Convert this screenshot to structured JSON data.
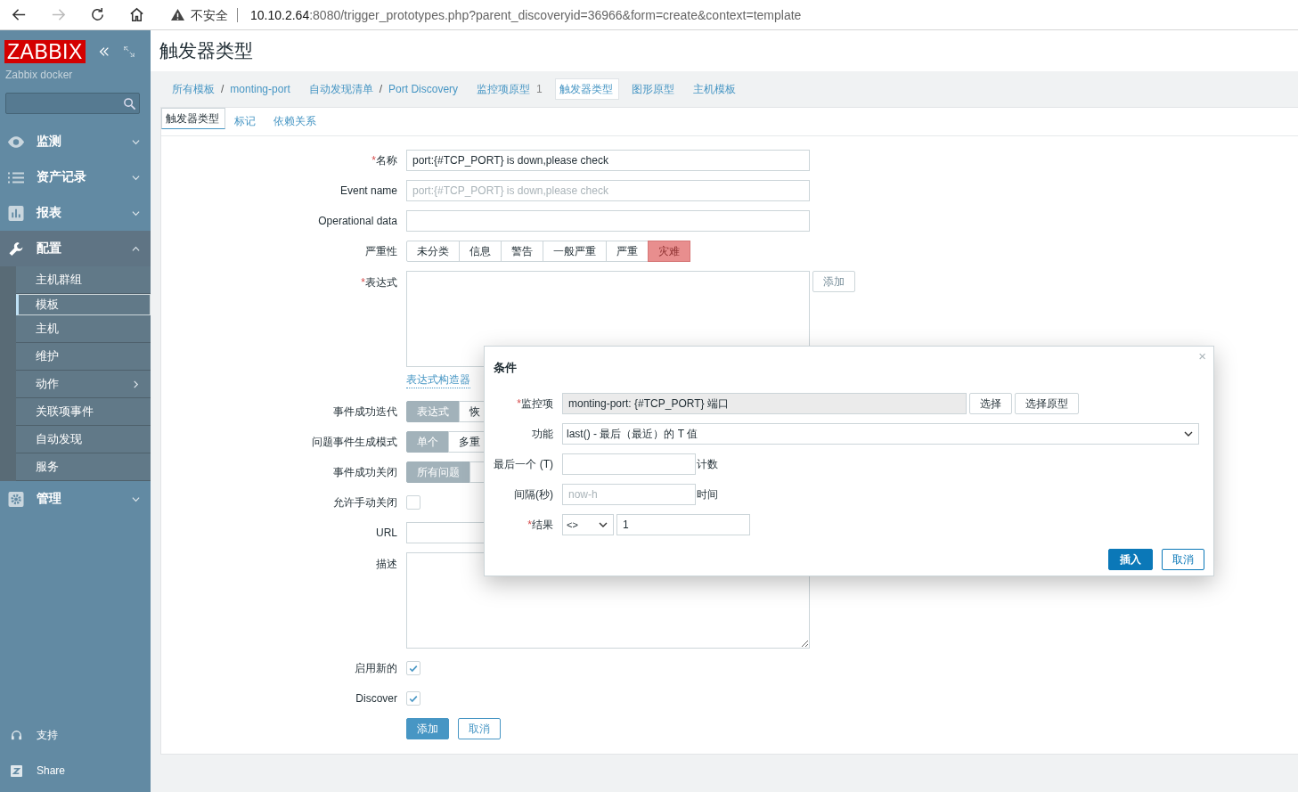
{
  "required_mark": "*",
  "browser": {
    "security": "不安全",
    "host": "10.10.2.64",
    "path": ":8080/trigger_prototypes.php?parent_discoveryid=36966&form=create&context=template"
  },
  "sidebar": {
    "logo": "ZABBIX",
    "server": "Zabbix docker",
    "menu": [
      {
        "label": "监测",
        "expanded": false
      },
      {
        "label": "资产记录",
        "expanded": false
      },
      {
        "label": "报表",
        "expanded": false
      },
      {
        "label": "配置",
        "expanded": true,
        "children": [
          {
            "label": "主机群组",
            "selected": false,
            "has_submenu": false
          },
          {
            "label": "模板",
            "selected": true,
            "has_submenu": false
          },
          {
            "label": "主机",
            "selected": false,
            "has_submenu": false
          },
          {
            "label": "维护",
            "selected": false,
            "has_submenu": false
          },
          {
            "label": "动作",
            "selected": false,
            "has_submenu": true
          },
          {
            "label": "关联项事件",
            "selected": false,
            "has_submenu": false
          },
          {
            "label": "自动发现",
            "selected": false,
            "has_submenu": false
          },
          {
            "label": "服务",
            "selected": false,
            "has_submenu": false
          }
        ]
      },
      {
        "label": "管理",
        "expanded": false
      }
    ],
    "footer": [
      "支持",
      "Share"
    ]
  },
  "page": {
    "title": "触发器类型",
    "breadcrumbs": {
      "separator": "/",
      "groups": [
        {
          "items": [
            "所有模板",
            "monting-port"
          ],
          "selected": false
        },
        {
          "items": [
            "自动发现清单",
            "Port Discovery"
          ],
          "selected": false
        },
        {
          "items": [
            "监控项原型"
          ],
          "count": "1",
          "selected": false
        },
        {
          "items": [
            "触发器类型"
          ],
          "selected": true
        },
        {
          "items": [
            "图形原型"
          ],
          "selected": false
        },
        {
          "items": [
            "主机模板"
          ],
          "selected": false
        }
      ]
    },
    "tabs": [
      {
        "label": "触发器类型",
        "selected": true
      },
      {
        "label": "标记",
        "selected": false
      },
      {
        "label": "依赖关系",
        "selected": false
      }
    ],
    "fields": [
      {
        "kind": "input",
        "label": "名称",
        "required": true,
        "value": "port:{#TCP_PORT} is down,please check"
      },
      {
        "kind": "input",
        "label": "Event name",
        "required": false,
        "placeholder": "port:{#TCP_PORT} is down,please check"
      },
      {
        "kind": "input",
        "label": "Operational data",
        "required": false
      },
      {
        "kind": "severity",
        "label": "严重性",
        "required": false,
        "options": [
          {
            "label": "未分类",
            "selected": false
          },
          {
            "label": "信息",
            "selected": false
          },
          {
            "label": "警告",
            "selected": false
          },
          {
            "label": "一般严重",
            "selected": false
          },
          {
            "label": "严重",
            "selected": false
          },
          {
            "label": "灾难",
            "selected": true
          }
        ]
      },
      {
        "kind": "expression",
        "label": "表达式",
        "required": true,
        "button": "添加",
        "link": "表达式构造器"
      },
      {
        "kind": "segmented",
        "label": "事件成功迭代",
        "required": false,
        "options": [
          {
            "label": "表达式",
            "selected": true
          },
          {
            "label": "恢",
            "selected": false
          }
        ]
      },
      {
        "kind": "segmented",
        "label": "问题事件生成模式",
        "required": false,
        "options": [
          {
            "label": "单个",
            "selected": true
          },
          {
            "label": "多重",
            "selected": false
          }
        ]
      },
      {
        "kind": "segmented",
        "label": "事件成功关闭",
        "required": false,
        "options": [
          {
            "label": "所有问题",
            "selected": true
          },
          {
            "selected": false
          }
        ]
      },
      {
        "kind": "checkbox",
        "label": "允许手动关闭",
        "required": false,
        "checked": false
      },
      {
        "kind": "input",
        "label": "URL",
        "required": false
      },
      {
        "kind": "textarea",
        "label": "描述",
        "required": false
      },
      {
        "kind": "checkbox",
        "label": "启用新的",
        "required": false,
        "checked": true
      },
      {
        "kind": "checkbox",
        "label": "Discover",
        "required": false,
        "checked": true
      }
    ],
    "actions": [
      {
        "label": "添加",
        "primary": true
      },
      {
        "label": "取消",
        "primary": false
      }
    ]
  },
  "dialog": {
    "title": "条件",
    "close": "×",
    "rows": [
      {
        "kind": "item",
        "label": "监控项",
        "required": true,
        "value": "monting-port: {#TCP_PORT} 端口",
        "buttons": [
          "选择",
          "选择原型"
        ]
      },
      {
        "kind": "select",
        "label": "功能",
        "required": false,
        "value": "last() - 最后（最近）的 T 值"
      },
      {
        "kind": "input",
        "label": "最后一个 (T)",
        "required": false,
        "suffix": "计数"
      },
      {
        "kind": "input",
        "label": "间隔(秒)",
        "required": false,
        "placeholder": "now-h",
        "suffix": "时间"
      },
      {
        "kind": "result",
        "label": "结果",
        "required": true,
        "operator": "<>",
        "value": "1"
      }
    ],
    "actions": [
      {
        "label": "插入",
        "primary": true
      },
      {
        "label": "取消",
        "primary": false
      }
    ]
  }
}
